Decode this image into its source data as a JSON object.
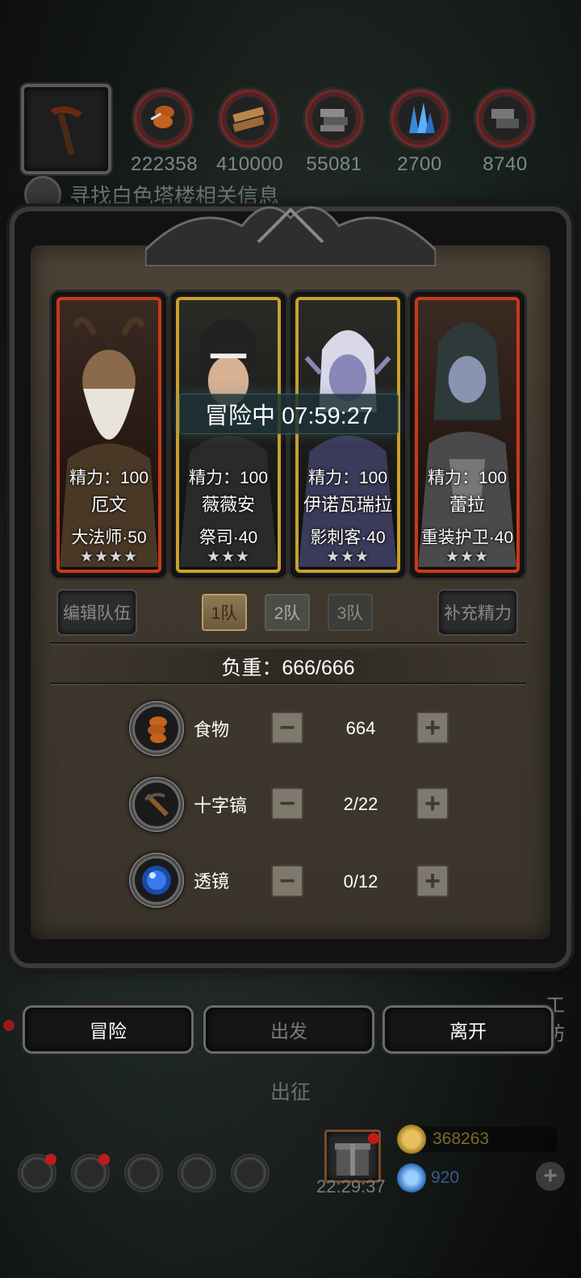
{
  "resources": [
    {
      "name": "food",
      "icon": "meat-icon",
      "value": "222358"
    },
    {
      "name": "wood",
      "icon": "wood-icon",
      "value": "410000"
    },
    {
      "name": "iron",
      "icon": "iron-icon",
      "value": "55081"
    },
    {
      "name": "crystal",
      "icon": "crystal-icon",
      "value": "2700"
    },
    {
      "name": "stone",
      "icon": "stone-icon",
      "value": "8740"
    }
  ],
  "quest": {
    "text": "寻找白色塔楼相关信息"
  },
  "adventure": {
    "status": "冒险中 07:59:27"
  },
  "heroes": [
    {
      "energy": "精力：100",
      "name": "厄文",
      "class": "大法师·50",
      "stars": "★★★★",
      "frame": "#c83a15"
    },
    {
      "energy": "精力：100",
      "name": "薇薇安",
      "class": "祭司·40",
      "stars": "★★★",
      "frame": "#c9a02d"
    },
    {
      "energy": "精力：100",
      "name": "伊诺瓦瑞拉",
      "class": "影刺客·40",
      "stars": "★★★",
      "frame": "#c9a02d"
    },
    {
      "energy": "精力：100",
      "name": "蕾拉",
      "class": "重装护卫·40",
      "stars": "★★★",
      "frame": "#c83a15"
    }
  ],
  "team": {
    "edit_label": "编辑队伍",
    "refill_label": "补充精力",
    "tabs": [
      "1队",
      "2队",
      "3队"
    ],
    "active_tab": "1队"
  },
  "load": {
    "label": "负重：666/666"
  },
  "supplies": [
    {
      "label": "食物",
      "value": "664",
      "icon": "meat-icon",
      "minus": "−",
      "plus": "+"
    },
    {
      "label": "十字镐",
      "value": "2/22",
      "icon": "pickaxe-icon",
      "minus": "−",
      "plus": "+"
    },
    {
      "label": "透镜",
      "value": "0/12",
      "icon": "lens-icon",
      "minus": "−",
      "plus": "+"
    }
  ],
  "actions": {
    "adventure": "冒险",
    "depart": "出发",
    "leave": "离开"
  },
  "expedition_label": "出征",
  "side_label": "工坊",
  "bottom": {
    "clock": "22:29:37",
    "gold": "368263",
    "gems": "920",
    "plus": "+"
  }
}
